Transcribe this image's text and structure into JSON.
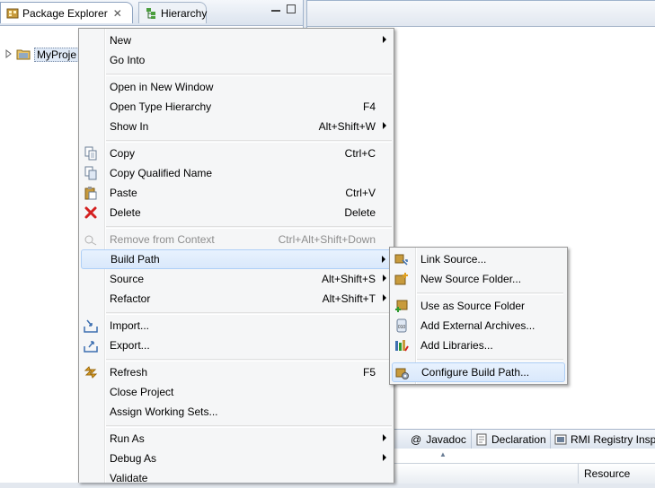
{
  "views": {
    "package_explorer_tab": "Package Explorer",
    "hierarchy_tab": "Hierarchy",
    "tree_item": "MyProje"
  },
  "bottom": {
    "tabs": [
      {
        "prefix": "@",
        "label": "Javadoc"
      },
      {
        "label": "Declaration"
      },
      {
        "label": "RMI Registry Inspe"
      }
    ],
    "column_resource": "Resource"
  },
  "context_menu": {
    "new": "New",
    "go_into": "Go Into",
    "open_new_window": "Open in New Window",
    "open_type_hierarchy": "Open Type Hierarchy",
    "open_type_hierarchy_accel": "F4",
    "show_in": "Show In",
    "show_in_accel": "Alt+Shift+W",
    "copy": "Copy",
    "copy_accel": "Ctrl+C",
    "copy_qualified": "Copy Qualified Name",
    "paste": "Paste",
    "paste_accel": "Ctrl+V",
    "delete": "Delete",
    "delete_accel": "Delete",
    "remove_context": "Remove from Context",
    "remove_context_accel": "Ctrl+Alt+Shift+Down",
    "build_path": "Build Path",
    "source": "Source",
    "source_accel": "Alt+Shift+S",
    "refactor": "Refactor",
    "refactor_accel": "Alt+Shift+T",
    "import": "Import...",
    "export": "Export...",
    "refresh": "Refresh",
    "refresh_accel": "F5",
    "close_project": "Close Project",
    "assign_working_sets": "Assign Working Sets...",
    "run_as": "Run As",
    "debug_as": "Debug As",
    "validate": "Validate"
  },
  "submenu": {
    "link_source": "Link Source...",
    "new_source_folder": "New Source Folder...",
    "use_as_source_folder": "Use as Source Folder",
    "add_external_archives": "Add External Archives...",
    "add_libraries": "Add Libraries...",
    "configure_build_path": "Configure Build Path..."
  },
  "colors": {
    "highlight": "#d9e8fb",
    "highlight_border": "#aecff7",
    "menu_bg": "#f5f6f7",
    "disabled_text": "#8d8d8d"
  }
}
